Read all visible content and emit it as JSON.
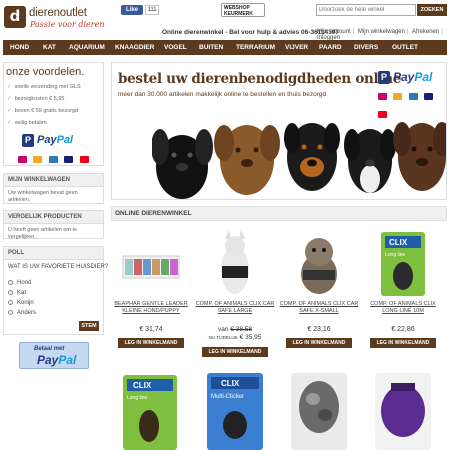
{
  "header": {
    "logo_letter": "d",
    "logo_name": "dierenoutlet",
    "logo_tagline": "Passie voor dieren",
    "fb_like": "Like",
    "fb_count": "111",
    "webshop_line1": "WEBSHOP",
    "webshop_line2": "KEURMERK",
    "search_placeholder": "Doorzoek de hele winkel",
    "search_button": "ZOEKEN",
    "contact": "Online dierenwinkel - Bel voor hulp & advies 06-36114197",
    "account_links": [
      "Mijn account",
      "Mijn winkelwagen",
      "Afrekenen",
      "Inloggen"
    ]
  },
  "nav": [
    "HOND",
    "KAT",
    "AQUARIUM",
    "KNAAGDIER",
    "VOGEL",
    "BUITEN",
    "TERRARIUM",
    "VIJVER",
    "PAARD",
    "DIVERS",
    "OUTLET"
  ],
  "sidebar": {
    "advantages_title": "onze voordelen.",
    "advantages": [
      "snelle verzending met GLS",
      "bezorgkosten € 5,95",
      "boven € 59 gratis bezorgd",
      "veilig betalen"
    ],
    "paypal": {
      "p": "P",
      "pay": "Pay",
      "pal": "Pal"
    },
    "cart_head": "MIJN WINKELWAGEN",
    "cart_text": "Uw winkelwagen bevat geen artikelen.",
    "compare_head": "VERGELIJK PRODUCTEN",
    "compare_text": "U heeft geen artikelen om te vergelijken.",
    "poll_head": "POLL",
    "poll_question": "WAT IS UW FAVORIETE HUISDIER?",
    "poll_options": [
      "Hond",
      "Kat",
      "Konijn",
      "Anders"
    ],
    "poll_button": "STEM",
    "paypal_button_top": "Betaal met",
    "paypal_button_pay": "Pay",
    "paypal_button_pal": "Pal"
  },
  "banner": {
    "title": "bestel uw dierenbenodigdheden online",
    "subtitle": "meer dan 30.000 artikelen makkelijk online te bestellen en thuis bezorgd"
  },
  "section_title": "ONLINE DIERENWINKEL",
  "products": [
    {
      "name": "BEAPHAR GENTLE LEADER KLEINE HOND/PUPPY",
      "price": "€ 31,74",
      "cart": "LEG IN WINKELMAND"
    },
    {
      "name": "COMP. OF ANIMALS CLIX CAR SAFE LARGE",
      "old_label": "van",
      "old_price": "€ 38,58",
      "new_label": "NU TIJDELIJK",
      "new_price": "€ 35,95",
      "cart": "LEG IN WINKELMAND"
    },
    {
      "name": "COMP. OF ANIMALS CLIX CAR SAFE X-SMALL",
      "price": "€ 23,16",
      "cart": "LEG IN WINKELMAND"
    },
    {
      "name": "COMP. OF ANIMALS CLIX LONG LINE 10M",
      "price": "€ 22,86",
      "cart": "LEG IN WINKELMAND"
    }
  ],
  "product_images": [
    {
      "label": ""
    },
    {
      "label": ""
    },
    {
      "label": ""
    },
    {
      "label": "CLIX",
      "sub": "Long line"
    },
    {
      "label": "CLIX",
      "sub": "Long line"
    },
    {
      "label": "CLIX",
      "sub": "Multi-Clicker"
    },
    {
      "label": "",
      "sub": ""
    },
    {
      "label": "",
      "sub": ""
    }
  ],
  "colors": {
    "brand": "#5c3a1e",
    "accent_red": "#c0392b",
    "paypal_dark": "#253b80",
    "paypal_light": "#179bd7"
  }
}
